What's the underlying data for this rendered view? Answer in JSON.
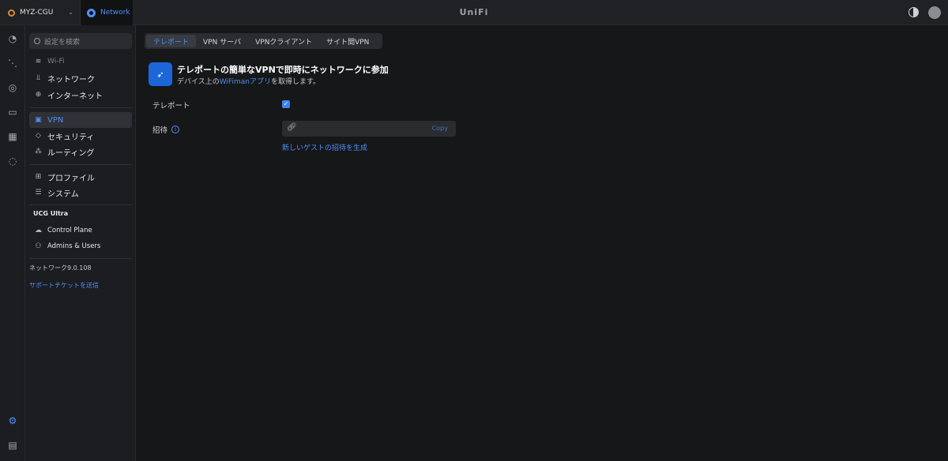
{
  "topbar": {
    "site_name": "MYZ-CGU",
    "app_tab_label": "Network",
    "brand": "UniFi"
  },
  "rail": {
    "icons": [
      "dashboard-icon",
      "topology-icon",
      "devices-icon",
      "clients-icon",
      "insights-icon",
      "alerts-icon",
      "settings-icon",
      "logs-icon"
    ]
  },
  "sidebar": {
    "search_placeholder": "設定を検索",
    "items": [
      {
        "label": "Wi-Fi"
      },
      {
        "label": "ネットワーク"
      },
      {
        "label": "インターネット"
      },
      {
        "label": "VPN"
      },
      {
        "label": "セキュリティ"
      },
      {
        "label": "ルーティング"
      },
      {
        "label": "プロファイル"
      },
      {
        "label": "システム"
      }
    ],
    "device_section": "UCG Ultra",
    "device_items": [
      {
        "label": "Control Plane"
      },
      {
        "label": "Admins & Users"
      }
    ],
    "version": "ネットワーク9.0.108",
    "support_link": "サポートチケットを送信"
  },
  "tabs": [
    {
      "label": "テレポート",
      "active": true
    },
    {
      "label": "VPN サーバ",
      "active": false
    },
    {
      "label": "VPNクライアント",
      "active": false
    },
    {
      "label": "サイト間VPN",
      "active": false
    }
  ],
  "main": {
    "hero_title": "テレポートの簡単なVPNで即時にネットワークに参加",
    "hero_sub_prefix": "デバイス上の",
    "hero_sub_link": "WiFimanアプリ",
    "hero_sub_suffix": "を取得します。",
    "teleport_label": "テレポート",
    "teleport_enabled": true,
    "invite_label": "招待",
    "copy_label": "Copy",
    "generate_link": "新しいゲストの招待を生成"
  },
  "colors": {
    "accent": "#4f8ff7",
    "background": "#161719",
    "panel": "#1c1d20"
  }
}
